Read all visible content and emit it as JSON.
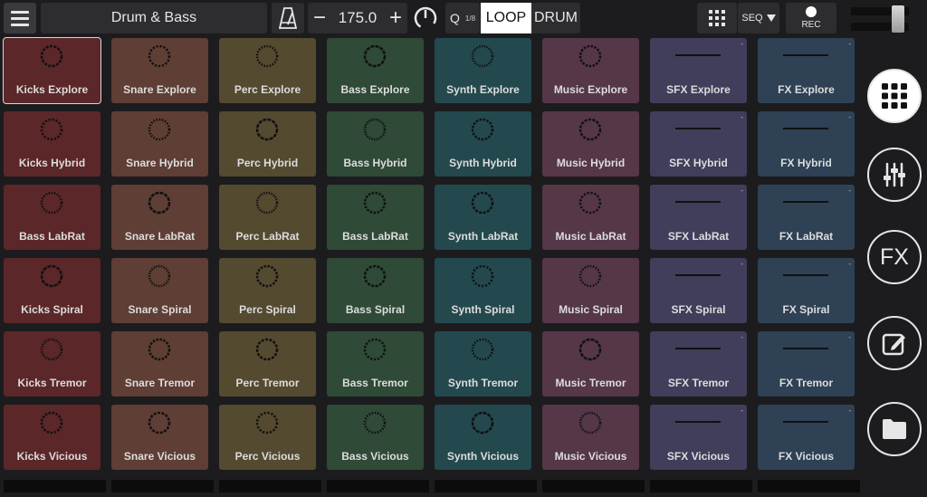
{
  "header": {
    "kit_name": "Drum & Bass",
    "bpm": "175.0",
    "minus_label": "−",
    "plus_label": "+",
    "quantize_label": "Q",
    "quantize_value": "1/8",
    "loop_label": "LOOP",
    "drum_label": "DRUM",
    "seq_label": "SEQ",
    "rec_label": "REC"
  },
  "colors": {
    "Kicks": "#5b2729",
    "Snare": "#5e3e35",
    "Perc": "#544a30",
    "Bass": "#2f4a37",
    "Synth": "#23494e",
    "Music": "#553748",
    "SFX": "#403e5a",
    "FX": "#2e4155"
  },
  "columns": [
    {
      "key": "Kicks",
      "icon": "ring",
      "pads": [
        {
          "label": "Kicks Explore"
        },
        {
          "label": "Kicks Hybrid"
        },
        {
          "label": "Bass LabRat"
        },
        {
          "label": "Kicks Spiral"
        },
        {
          "label": "Kicks Tremor"
        },
        {
          "label": "Kicks Vicious"
        }
      ]
    },
    {
      "key": "Snare",
      "icon": "ring",
      "pads": [
        {
          "label": "Snare Explore"
        },
        {
          "label": "Snare Hybrid"
        },
        {
          "label": "Snare LabRat"
        },
        {
          "label": "Snare Spiral"
        },
        {
          "label": "Snare Tremor"
        },
        {
          "label": "Snare Vicious"
        }
      ]
    },
    {
      "key": "Perc",
      "icon": "ring",
      "pads": [
        {
          "label": "Perc Explore"
        },
        {
          "label": "Perc Hybrid"
        },
        {
          "label": "Perc LabRat"
        },
        {
          "label": "Perc Spiral"
        },
        {
          "label": "Perc Tremor"
        },
        {
          "label": "Perc Vicious"
        }
      ]
    },
    {
      "key": "Bass",
      "icon": "ring",
      "pads": [
        {
          "label": "Bass Explore"
        },
        {
          "label": "Bass Hybrid"
        },
        {
          "label": "Bass LabRat"
        },
        {
          "label": "Bass Spiral"
        },
        {
          "label": "Bass Tremor"
        },
        {
          "label": "Bass Vicious"
        }
      ]
    },
    {
      "key": "Synth",
      "icon": "ring",
      "pads": [
        {
          "label": "Synth Explore"
        },
        {
          "label": "Synth Hybrid"
        },
        {
          "label": "Synth LabRat"
        },
        {
          "label": "Synth Spiral"
        },
        {
          "label": "Synth Tremor"
        },
        {
          "label": "Synth Vicious"
        }
      ]
    },
    {
      "key": "Music",
      "icon": "ring",
      "pads": [
        {
          "label": "Music Explore"
        },
        {
          "label": "Music Hybrid"
        },
        {
          "label": "Music LabRat"
        },
        {
          "label": "Music Spiral"
        },
        {
          "label": "Music Tremor"
        },
        {
          "label": "Music Vicious"
        }
      ]
    },
    {
      "key": "SFX",
      "icon": "line",
      "pads": [
        {
          "label": "SFX Explore"
        },
        {
          "label": "SFX Hybrid"
        },
        {
          "label": "SFX LabRat"
        },
        {
          "label": "SFX Spiral"
        },
        {
          "label": "SFX Tremor"
        },
        {
          "label": "SFX Vicious"
        }
      ]
    },
    {
      "key": "FX",
      "icon": "line",
      "pads": [
        {
          "label": "FX Explore"
        },
        {
          "label": "FX Hybrid"
        },
        {
          "label": "FX LabRat"
        },
        {
          "label": "FX Spiral"
        },
        {
          "label": "FX Tremor"
        },
        {
          "label": "FX Vicious"
        }
      ]
    }
  ],
  "selected_pad": "Kicks Explore",
  "sidebar": {
    "fx_label": "FX"
  }
}
